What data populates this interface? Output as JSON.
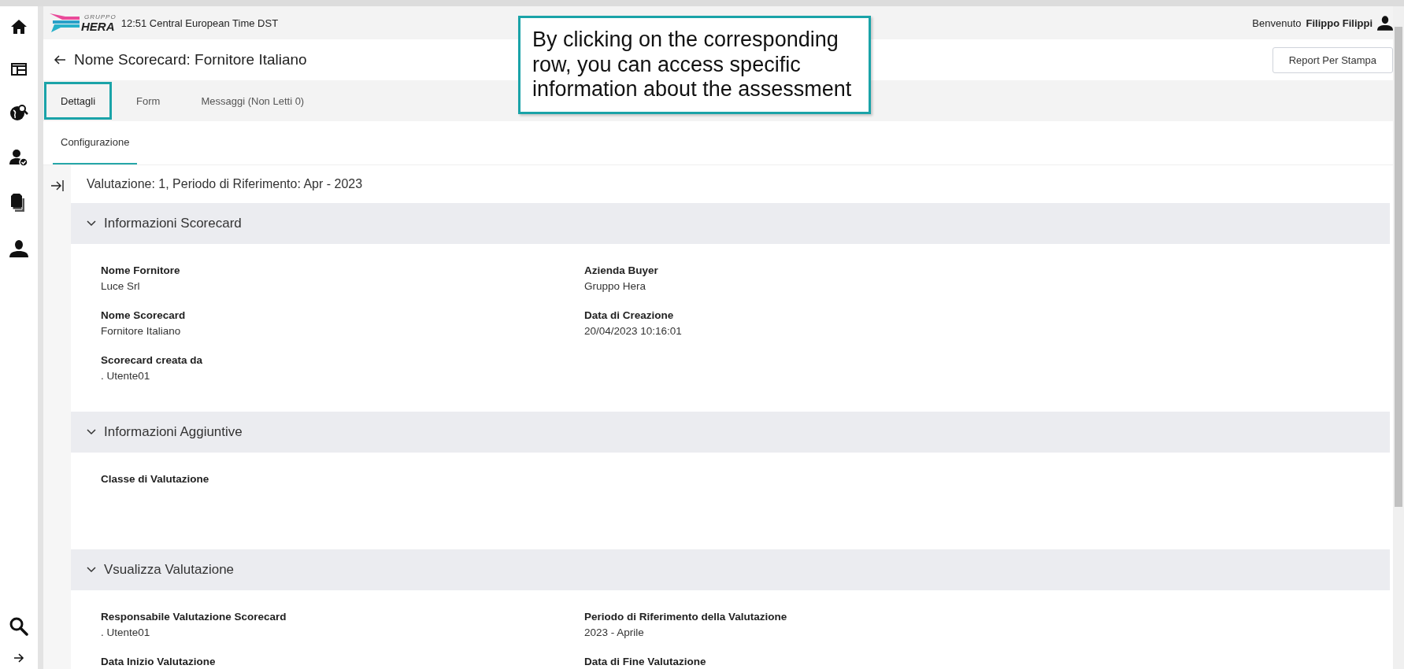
{
  "header": {
    "logo": "HERA",
    "logo_small": "GRUPPO",
    "time": "12:51 Central European Time DST",
    "welcome": "Benvenuto",
    "user": "Filippo Filippi"
  },
  "page": {
    "title": "Nome Scorecard: Fornitore Italiano",
    "report_button": "Report Per Stampa"
  },
  "tabs": [
    {
      "label": "Dettagli",
      "selected": true,
      "highlighted": true
    },
    {
      "label": "Form",
      "selected": false,
      "highlighted": false
    },
    {
      "label": "Messaggi (Non Letti 0)",
      "selected": false,
      "highlighted": false
    }
  ],
  "subtabs": [
    {
      "label": "Configurazione",
      "selected": true
    }
  ],
  "evaluation_heading": "Valutazione: 1, Periodo di Riferimento: Apr - 2023",
  "sections": [
    {
      "title": "Informazioni Scorecard",
      "expanded": true,
      "fields": [
        {
          "label": "Nome Fornitore",
          "value": "Luce Srl"
        },
        {
          "label": "Azienda Buyer",
          "value": "Gruppo Hera"
        },
        {
          "label": "Nome Scorecard",
          "value": "Fornitore Italiano"
        },
        {
          "label": "Data di Creazione",
          "value": "20/04/2023 10:16:01"
        },
        {
          "label": "Scorecard creata da",
          "value": ". Utente01"
        }
      ]
    },
    {
      "title": "Informazioni Aggiuntive",
      "expanded": true,
      "fields": [
        {
          "label": "Classe di Valutazione"
        }
      ]
    },
    {
      "title": "Vsualizza Valutazione",
      "expanded": true,
      "fields": [
        {
          "label": "Responsabile Valutazione Scorecard",
          "value": ". Utente01"
        },
        {
          "label": "Periodo di Riferimento della Valutazione",
          "value": "2023 - Aprile"
        },
        {
          "label": "Data Inizio Valutazione"
        },
        {
          "label": "Data di Fine Valutazione"
        }
      ]
    }
  ],
  "annotation": {
    "text": "By clicking on the corresponding row, you can access specific information about the assessment"
  }
}
